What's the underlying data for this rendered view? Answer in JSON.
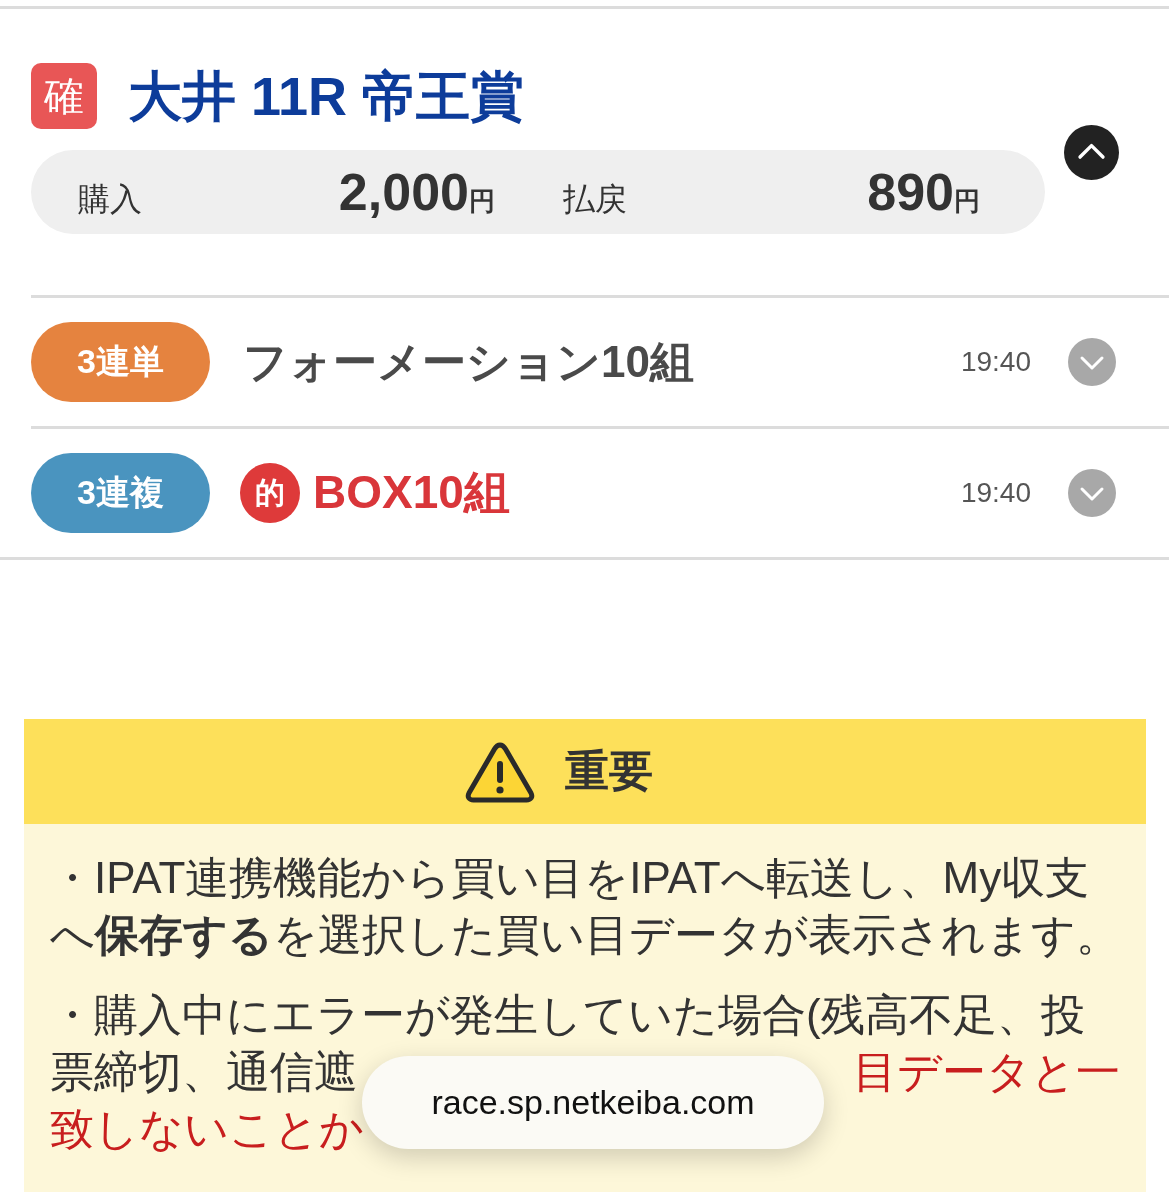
{
  "race": {
    "badge": "確",
    "title": "大井 11R 帝王賞",
    "expanded": true,
    "purchase": {
      "label": "購入",
      "amount": "2,000",
      "unit": "円"
    },
    "payout": {
      "label": "払戻",
      "amount": "890",
      "unit": "円"
    }
  },
  "bets": [
    {
      "type": "3連単",
      "color": "#e5833f",
      "hit": false,
      "description": "フォーメーション10組",
      "time": "19:40",
      "expanded": false
    },
    {
      "type": "3連複",
      "color": "#4a94bf",
      "hit": true,
      "hit_mark": "的",
      "description": "BOX10組",
      "time": "19:40",
      "expanded": false
    }
  ],
  "notice": {
    "title": "重要",
    "paragraphs": [
      {
        "kind": "text",
        "text": "・IPAT連携機能から買い目をIPATへ転送し、My収支へ**保存する**を選択した買い目データが表示されます。"
      },
      {
        "kind": "lines",
        "lines": [
          {
            "segments": [
              {
                "kind": "plain",
                "text": "・購入中にエラーが発生していた場合(残高不足、投"
              }
            ]
          },
          {
            "segments": [
              {
                "kind": "plain",
                "text": "票締切、通信遮"
              },
              {
                "kind": "alert",
                "text": "目データと一"
              }
            ]
          },
          {
            "segments": [
              {
                "kind": "alert",
                "text": "致しないことか"
              }
            ]
          }
        ]
      }
    ]
  },
  "url_toast": {
    "text": "race.sp.netkeiba.com"
  }
}
